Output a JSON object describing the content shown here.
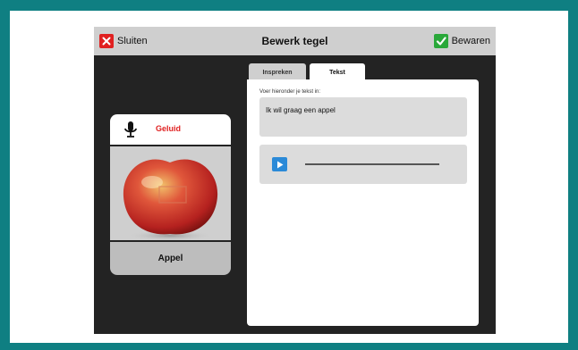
{
  "topbar": {
    "close_label": "Sluiten",
    "title": "Bewerk tegel",
    "save_label": "Bewaren"
  },
  "tile": {
    "sound_label": "Geluid",
    "image_subject": "apple",
    "name": "Appel"
  },
  "editor": {
    "tabs": [
      {
        "label": "Inspreken",
        "active": false
      },
      {
        "label": "Tekst",
        "active": true
      }
    ],
    "instruction": "Voer hieronder je tekst in:",
    "text_value": "Ik wil graag een appel",
    "audio_progress": 0
  },
  "colors": {
    "frame": "#0f7f82",
    "close": "#e02020",
    "save": "#2aa83a",
    "play": "#2b8ad8",
    "sound_label": "#e02020"
  },
  "icons": [
    "close-icon",
    "check-icon",
    "microphone-icon",
    "play-icon"
  ]
}
